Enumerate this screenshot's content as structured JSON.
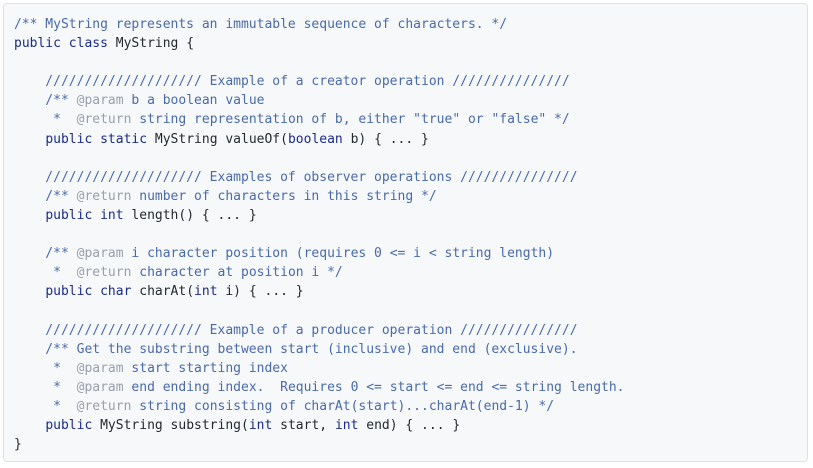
{
  "code_block": {
    "lines": [
      [
        {
          "c": "cm",
          "t": "/** MyString represents an immutable sequence of characters. */"
        }
      ],
      [
        {
          "c": "kw",
          "t": "public"
        },
        {
          "c": "tx",
          "t": " "
        },
        {
          "c": "kw",
          "t": "class"
        },
        {
          "c": "tx",
          "t": " MyString {"
        }
      ],
      [],
      [
        {
          "c": "cm",
          "t": "    //////////////////// Example of a creator operation ///////////////"
        }
      ],
      [
        {
          "c": "cm",
          "t": "    /** "
        },
        {
          "c": "tag",
          "t": "@param"
        },
        {
          "c": "cm",
          "t": " b a boolean value"
        }
      ],
      [
        {
          "c": "cm",
          "t": "     *  "
        },
        {
          "c": "tag",
          "t": "@return"
        },
        {
          "c": "cm",
          "t": " string representation of b, either \"true\" or \"false\" */"
        }
      ],
      [
        {
          "c": "tx",
          "t": "    "
        },
        {
          "c": "kw",
          "t": "public"
        },
        {
          "c": "tx",
          "t": " "
        },
        {
          "c": "kw",
          "t": "static"
        },
        {
          "c": "tx",
          "t": " MyString valueOf("
        },
        {
          "c": "kw",
          "t": "boolean"
        },
        {
          "c": "tx",
          "t": " b) { ... }"
        }
      ],
      [],
      [
        {
          "c": "cm",
          "t": "    //////////////////// Examples of observer operations ///////////////"
        }
      ],
      [
        {
          "c": "cm",
          "t": "    /** "
        },
        {
          "c": "tag",
          "t": "@return"
        },
        {
          "c": "cm",
          "t": " number of characters in this string */"
        }
      ],
      [
        {
          "c": "tx",
          "t": "    "
        },
        {
          "c": "kw",
          "t": "public"
        },
        {
          "c": "tx",
          "t": " "
        },
        {
          "c": "kw",
          "t": "int"
        },
        {
          "c": "tx",
          "t": " length() { ... }"
        }
      ],
      [],
      [
        {
          "c": "cm",
          "t": "    /** "
        },
        {
          "c": "tag",
          "t": "@param"
        },
        {
          "c": "cm",
          "t": " i character position (requires 0 <= i < string length)"
        }
      ],
      [
        {
          "c": "cm",
          "t": "     *  "
        },
        {
          "c": "tag",
          "t": "@return"
        },
        {
          "c": "cm",
          "t": " character at position i */"
        }
      ],
      [
        {
          "c": "tx",
          "t": "    "
        },
        {
          "c": "kw",
          "t": "public"
        },
        {
          "c": "tx",
          "t": " "
        },
        {
          "c": "kw",
          "t": "char"
        },
        {
          "c": "tx",
          "t": " charAt("
        },
        {
          "c": "kw",
          "t": "int"
        },
        {
          "c": "tx",
          "t": " i) { ... }"
        }
      ],
      [],
      [
        {
          "c": "cm",
          "t": "    //////////////////// Example of a producer operation ///////////////"
        }
      ],
      [
        {
          "c": "cm",
          "t": "    /** Get the substring between start (inclusive) and end (exclusive)."
        }
      ],
      [
        {
          "c": "cm",
          "t": "     *  "
        },
        {
          "c": "tag",
          "t": "@param"
        },
        {
          "c": "cm",
          "t": " start starting index"
        }
      ],
      [
        {
          "c": "cm",
          "t": "     *  "
        },
        {
          "c": "tag",
          "t": "@param"
        },
        {
          "c": "cm",
          "t": " end ending index.  Requires 0 <= start <= end <= string length."
        }
      ],
      [
        {
          "c": "cm",
          "t": "     *  "
        },
        {
          "c": "tag",
          "t": "@return"
        },
        {
          "c": "cm",
          "t": " string consisting of charAt(start)...charAt(end-1) */"
        }
      ],
      [
        {
          "c": "tx",
          "t": "    "
        },
        {
          "c": "kw",
          "t": "public"
        },
        {
          "c": "tx",
          "t": " MyString substring("
        },
        {
          "c": "kw",
          "t": "int"
        },
        {
          "c": "tx",
          "t": " start, "
        },
        {
          "c": "kw",
          "t": "int"
        },
        {
          "c": "tx",
          "t": " end) { ... }"
        }
      ],
      [
        {
          "c": "tx",
          "t": "}"
        }
      ]
    ]
  }
}
